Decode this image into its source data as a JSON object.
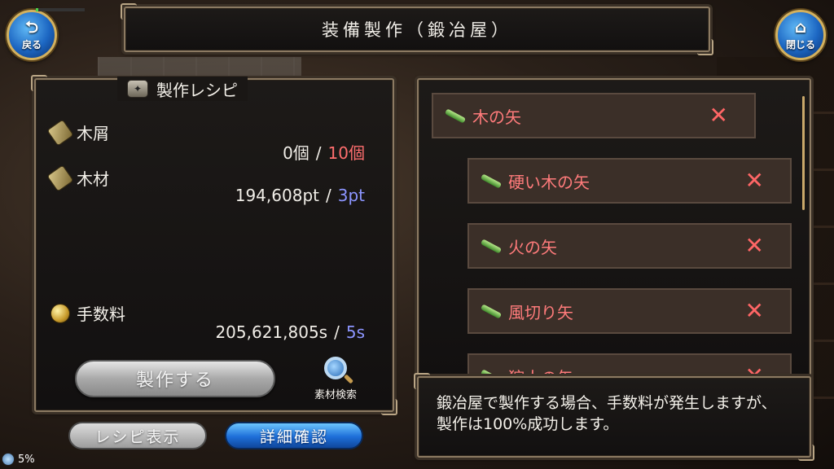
{
  "title": "装備製作（鍛冶屋）",
  "nav": {
    "back_label": "戻る",
    "close_label": "閉じる"
  },
  "recipe": {
    "header": "製作レシピ",
    "materials": [
      {
        "name": "木屑",
        "have": "0個",
        "need": "10個"
      },
      {
        "name": "木材",
        "have": "194,608pt",
        "need": "3pt"
      }
    ],
    "fee": {
      "name": "手数料",
      "have": "205,621,805s",
      "need": "5s"
    },
    "separator": "/",
    "craft_button": "製作する",
    "search_label": "素材検索"
  },
  "bottom_buttons": {
    "recipe_view": "レシピ表示",
    "detail": "詳細確認"
  },
  "list": {
    "items": [
      {
        "name": "木の矢",
        "status": "✕"
      },
      {
        "name": "硬い木の矢",
        "status": "✕"
      },
      {
        "name": "火の矢",
        "status": "✕"
      },
      {
        "name": "風切り矢",
        "status": "✕"
      },
      {
        "name": "狩人の矢",
        "status": "✕"
      }
    ]
  },
  "message": "鍛冶屋で製作する場合、手数料が発生しますが、製作は100%成功します。",
  "status": {
    "text": "5%",
    "level": 0.05
  },
  "colors": {
    "need_red": "#ff6e6e",
    "need_blue": "#8c95ff",
    "item_name": "#ff7b7b",
    "accent_blue": "#1d6ed8"
  }
}
